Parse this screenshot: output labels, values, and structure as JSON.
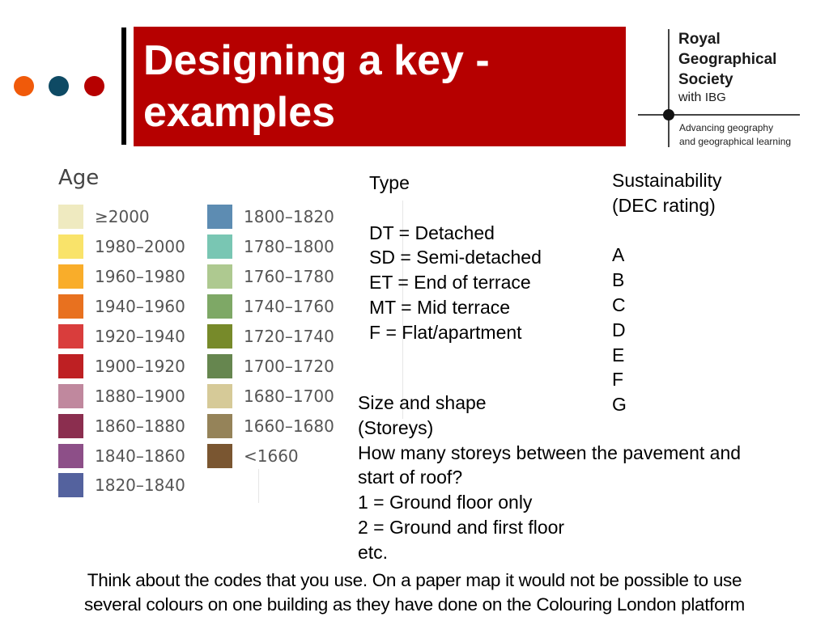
{
  "header": {
    "title_lines": [
      "Designing a key -",
      "examples"
    ],
    "dots": [
      "#f05a0a",
      "#0e4a64",
      "#b60000"
    ],
    "title_bg": "#b60000"
  },
  "logo": {
    "name_lines": [
      "Royal",
      "Geographical",
      "Society"
    ],
    "with": "with",
    "ibg": "IBG",
    "tagline_lines": [
      "Advancing geography",
      "and geographical learning"
    ]
  },
  "age_key": {
    "title": "Age",
    "columns": [
      [
        {
          "label": "≥2000",
          "color": "#efeac0"
        },
        {
          "label": "1980–2000",
          "color": "#f9e36a"
        },
        {
          "label": "1960–1980",
          "color": "#f9ad2a"
        },
        {
          "label": "1940–1960",
          "color": "#e8711f"
        },
        {
          "label": "1920–1940",
          "color": "#d93d3c"
        },
        {
          "label": "1900–1920",
          "color": "#be2023"
        },
        {
          "label": "1880–1900",
          "color": "#c0889e"
        },
        {
          "label": "1860–1880",
          "color": "#8b2e4f"
        },
        {
          "label": "1840–1860",
          "color": "#8d4f88"
        },
        {
          "label": "1820–1840",
          "color": "#54629e"
        }
      ],
      [
        {
          "label": "1800–1820",
          "color": "#5d8cb2"
        },
        {
          "label": "1780–1800",
          "color": "#79c6b3"
        },
        {
          "label": "1760–1780",
          "color": "#aec990"
        },
        {
          "label": "1740–1760",
          "color": "#7ea866"
        },
        {
          "label": "1720–1740",
          "color": "#778a2a"
        },
        {
          "label": "1700–1720",
          "color": "#66864f"
        },
        {
          "label": "1680–1700",
          "color": "#d6ca98"
        },
        {
          "label": "1660–1680",
          "color": "#958359"
        },
        {
          "label": "<1660",
          "color": "#7a5631"
        }
      ]
    ]
  },
  "type_key": {
    "title": "Type",
    "items": [
      "DT = Detached",
      "SD = Semi-detached",
      "ET = End of terrace",
      "MT = Mid terrace",
      "F = Flat/apartment"
    ]
  },
  "sustainability_key": {
    "title_lines": [
      "Sustainability",
      "(DEC rating)"
    ],
    "ratings": [
      "A",
      "B",
      "C",
      "D",
      "E",
      "F",
      "G"
    ]
  },
  "size_key": {
    "lines": [
      "Size and shape",
      "(Storeys)",
      "How many storeys between the pavement and",
      "start of roof?",
      "1 = Ground floor only",
      "2 = Ground and first floor",
      "etc."
    ]
  },
  "footer": {
    "lines": [
      "Think about the codes that you use. On a paper map it would not be possible to use",
      "several colours on one building as they have done on the Colouring London platform"
    ]
  }
}
